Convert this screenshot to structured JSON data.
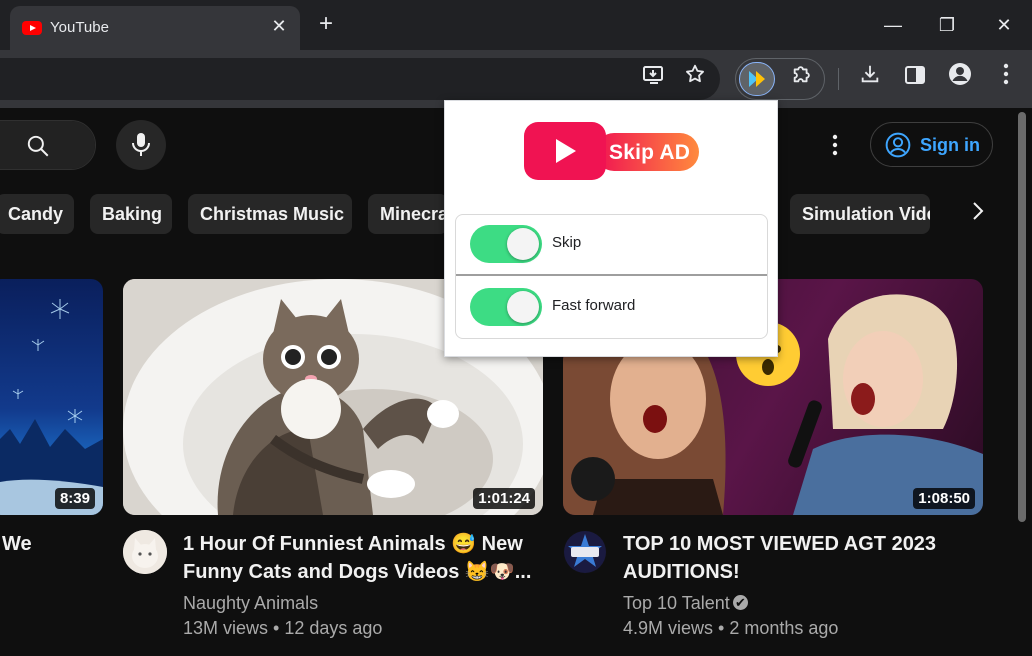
{
  "browser": {
    "tab_title": "YouTube",
    "tab_close": "✕",
    "new_tab": "+",
    "window_minimize": "—",
    "window_restore": "❐",
    "window_close": "✕"
  },
  "youtube": {
    "sign_in": "Sign in",
    "chips": [
      "Candy",
      "Baking",
      "Christmas Music",
      "Minecraft",
      "Simulation Videos"
    ],
    "videos": [
      {
        "title_lines": [
          "We"
        ],
        "duration": "8:39"
      },
      {
        "title_lines": [
          "1 Hour Of Funniest Animals 😅 New",
          "Funny Cats and Dogs Videos 😸🐶..."
        ],
        "channel": "Naughty Animals",
        "meta": "13M views • 12 days ago",
        "duration": "1:01:24"
      },
      {
        "title_lines": [
          "TOP 10 MOST VIEWED AGT 2023",
          "AUDITIONS!"
        ],
        "channel": "Top 10 Talent",
        "verified": "✔",
        "meta": "4.9M views • 2 months ago",
        "duration": "1:08:50"
      }
    ]
  },
  "extension_popup": {
    "logo_text": "Skip AD",
    "options": [
      {
        "label": "Skip",
        "enabled": true
      },
      {
        "label": "Fast forward",
        "enabled": true
      }
    ]
  },
  "colors": {
    "youtube_red": "#ff0000",
    "toggle_on": "#3ddc84",
    "link_blue": "#3ea6ff",
    "logo_pink": "#f01352"
  }
}
